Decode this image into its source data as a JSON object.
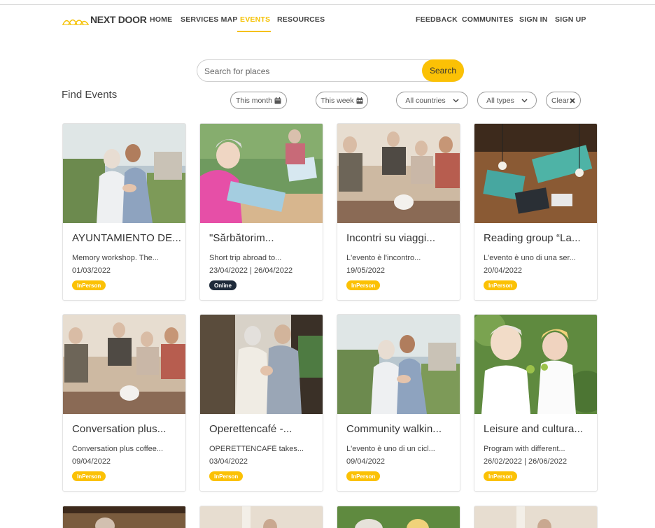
{
  "nav": {
    "logo_text": "NEXT DOOR",
    "links": [
      "HOME",
      "SERVICES MAP",
      "EVENTS",
      "RESOURCES"
    ],
    "right_links": [
      "FEEDBACK",
      "COMMUNITES",
      "SIGN IN",
      "SIGN UP"
    ],
    "active": "EVENTS",
    "accent_color": "#f5c100"
  },
  "search": {
    "placeholder": "Search for places",
    "button_label": "Search"
  },
  "page_heading": "Find Events",
  "filters": {
    "this_month": "This month",
    "this_week": "This week",
    "country": "All countries",
    "type": "All types",
    "clear": "Clear"
  },
  "events": [
    {
      "title": "AYUNTAMIENTO DE...",
      "desc": "Memory workshop. The...",
      "date": "01/03/2022",
      "mode": "InPerson"
    },
    {
      "title": "\"Sărbătorim...",
      "desc": "Short trip abroad to...",
      "date": "23/04/2022 | 26/04/2022",
      "mode": "Online"
    },
    {
      "title": "Incontri su viaggi...",
      "desc": "L'evento è l'incontro...",
      "date": "19/05/2022",
      "mode": "InPerson"
    },
    {
      "title": "Reading group “La...",
      "desc": "L'evento è uno di una ser...",
      "date": "20/04/2022",
      "mode": "InPerson"
    },
    {
      "title": "Conversation plus...",
      "desc": "Conversation plus coffee...",
      "date": "09/04/2022",
      "mode": "InPerson"
    },
    {
      "title": "Operettencafé -...",
      "desc": "OPERETTENCAFÉ takes...",
      "date": "03/04/2022",
      "mode": "InPerson"
    },
    {
      "title": "Community walkin...",
      "desc": "L'evento è uno di un cicl...",
      "date": "09/04/2022",
      "mode": "InPerson"
    },
    {
      "title": "Leisure and cultura...",
      "desc": "Program with different...",
      "date": "26/02/2022 | 26/06/2022",
      "mode": "InPerson"
    }
  ],
  "colors": {
    "badge_inperson": "#fbc105",
    "badge_online": "#1e2a3a",
    "search_button": "#fbc105"
  }
}
